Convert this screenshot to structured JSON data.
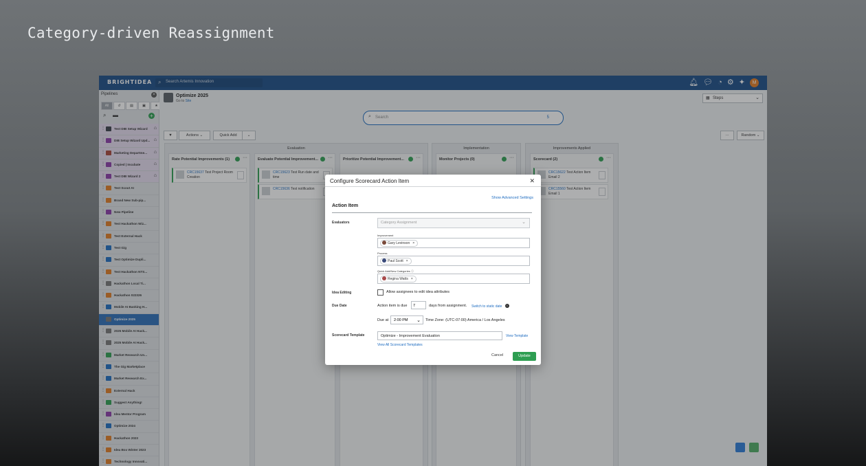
{
  "page_heading": "Category-driven Reassignment",
  "app": {
    "logo": "BRIGHTIDEA",
    "search_placeholder": "Search Artemis Innovation",
    "avatar_initial": "M",
    "top_icons": [
      "bell-icon",
      "chat-icon",
      "clock-icon",
      "gear-icon",
      "sparkle-icon"
    ]
  },
  "sidebar": {
    "title": "Pipelines",
    "filters": [
      "All",
      "↺",
      "▤",
      "▣",
      "★"
    ],
    "items": [
      {
        "label": "Test DIB Setup Wizard",
        "color": "#3a3f4a",
        "style": "purple",
        "home": true
      },
      {
        "label": "DIB Setup Wizard Upd...",
        "color": "#8c3aa8",
        "style": "purple",
        "home": true
      },
      {
        "label": "Marketing Departme...",
        "color": "#a8463a",
        "style": "purple",
        "home": true
      },
      {
        "label": "Copied | Incubate",
        "color": "#8c3aa8",
        "style": "purple",
        "home": true
      },
      {
        "label": "Test DIB Wizard 2",
        "color": "#8c3aa8",
        "style": "purple",
        "home": true
      },
      {
        "label": "Test Scout AI",
        "color": "#e07b22",
        "style": "",
        "home": false
      },
      {
        "label": "Brand New Sub-pip...",
        "color": "#e07b22",
        "style": "",
        "home": false
      },
      {
        "label": "New Pipeline",
        "color": "#8c3aa8",
        "style": "",
        "home": false
      },
      {
        "label": "Test Hackathon Wiz...",
        "color": "#e07b22",
        "style": "",
        "home": false
      },
      {
        "label": "Test External Hack",
        "color": "#e07b22",
        "style": "",
        "home": false
      },
      {
        "label": "Test Gig",
        "color": "#1e6cc0",
        "style": "",
        "home": false
      },
      {
        "label": "Test Optimize Dupli...",
        "color": "#1e6cc0",
        "style": "",
        "home": false
      },
      {
        "label": "Test Hackathon NTS...",
        "color": "#e07b22",
        "style": "",
        "home": false
      },
      {
        "label": "Hackathon Local Ti...",
        "color": "#777777",
        "style": "",
        "home": false
      },
      {
        "label": "Hackathon 022326",
        "color": "#e07b22",
        "style": "",
        "home": false
      },
      {
        "label": "Mobile AI Banking H...",
        "color": "#1e6cc0",
        "style": "",
        "home": false
      },
      {
        "label": "Optimize 2025",
        "color": "#777777",
        "style": "active",
        "home": false
      },
      {
        "label": "2025 Mobile AI Hack...",
        "color": "#777777",
        "style": "",
        "home": false
      },
      {
        "label": "2025 Mobile AI Hack...",
        "color": "#777777",
        "style": "",
        "home": false
      },
      {
        "label": "Market Research Un...",
        "color": "#2e9e52",
        "style": "",
        "home": false
      },
      {
        "label": "The Gig Marketplace",
        "color": "#1e6cc0",
        "style": "",
        "home": false
      },
      {
        "label": "Market Research Ex...",
        "color": "#1e6cc0",
        "style": "",
        "home": false
      },
      {
        "label": "External Hack",
        "color": "#e07b22",
        "style": "",
        "home": false
      },
      {
        "label": "Suggest Anything!",
        "color": "#2e9e52",
        "style": "",
        "home": false
      },
      {
        "label": "Idea Mentor Program",
        "color": "#8c3aa8",
        "style": "",
        "home": false
      },
      {
        "label": "Optimize 2024",
        "color": "#1e6cc0",
        "style": "",
        "home": false
      },
      {
        "label": "Hackathon 2023",
        "color": "#e07b22",
        "style": "",
        "home": false
      },
      {
        "label": "Idea Box Winter 2023",
        "color": "#e07b22",
        "style": "",
        "home": false
      },
      {
        "label": "Technology Innovati...",
        "color": "#e07b22",
        "style": "",
        "home": false
      },
      {
        "label": "Innovation Challenge...",
        "color": "#e07b22",
        "style": "",
        "home": false
      }
    ]
  },
  "main": {
    "title": "Optimize 2025",
    "subtitle_prefix": "Go to ",
    "subtitle_link": "Site",
    "steps_label": "Steps",
    "search_placeholder": "Search",
    "search_count": "5",
    "toolbar": {
      "actions": "Actions",
      "quick_add": "Quick Add",
      "more": "···",
      "sort": "Random"
    },
    "phases": [
      {
        "title": "Evaluation"
      },
      {
        "title": "Implementation"
      },
      {
        "title": "Improvements Applied"
      }
    ],
    "columns": [
      {
        "title": "Rate Potential Improvements (1)",
        "cards": [
          {
            "id": "CRC15637",
            "text": "Test Project Room Creation"
          }
        ]
      },
      {
        "title": "Evaluate Potential Improvement...",
        "cards": [
          {
            "id": "CRC15623",
            "text": "Test Run date and time"
          },
          {
            "id": "CRC15636",
            "text": "Test notification"
          }
        ]
      },
      {
        "title": "Prioritize Potential Improvement...",
        "cards": []
      },
      {
        "title": "Monitor Projects (0)",
        "cards": []
      },
      {
        "title": "Scorecard (2)",
        "cards": [
          {
            "id": "CRC15622",
            "text": "Test Action Item Email 2"
          },
          {
            "id": "CRC15560",
            "text": "Test Action Item Email 1"
          }
        ]
      }
    ]
  },
  "modal": {
    "title": "Configure Scorecard Action Item",
    "show_advanced": "Show Advanced Settings",
    "section": "Action Item",
    "evaluators_label": "Evaluators",
    "category_placeholder": "Category Assignment",
    "groups": [
      {
        "label": "Improvement",
        "person": "Gary Levinson",
        "avatar_color": "#7a4a3a"
      },
      {
        "label": "Process",
        "person": "Paul Scott",
        "avatar_color": "#3a4a7a"
      },
      {
        "label": "Quick Add/New Categories",
        "person": "Regina Watts",
        "avatar_color": "#a84a4a"
      }
    ],
    "idea_editing_label": "Idea Editing",
    "idea_editing_text": "Allow assignees to edit idea attributes",
    "idea_editing_checked": false,
    "due_date_label": "Due Date",
    "due_prefix": "Action item is due",
    "due_days": "7",
    "due_suffix": "days from assignment.",
    "switch_link": "Switch to static date",
    "due_at_label": "Due at",
    "due_time": "2:00 PM",
    "timezone": "Time Zone: (UTC-07:00) America / Los Angeles",
    "template_label": "Scorecard Template",
    "template_value": "Optimize - Improvement Evaluation",
    "view_template": "View Template",
    "view_all": "View All Scorecard Templates",
    "cancel": "Cancel",
    "update": "Update",
    "accent_color": "#2e9e52",
    "link_color": "#1e6cc0"
  }
}
